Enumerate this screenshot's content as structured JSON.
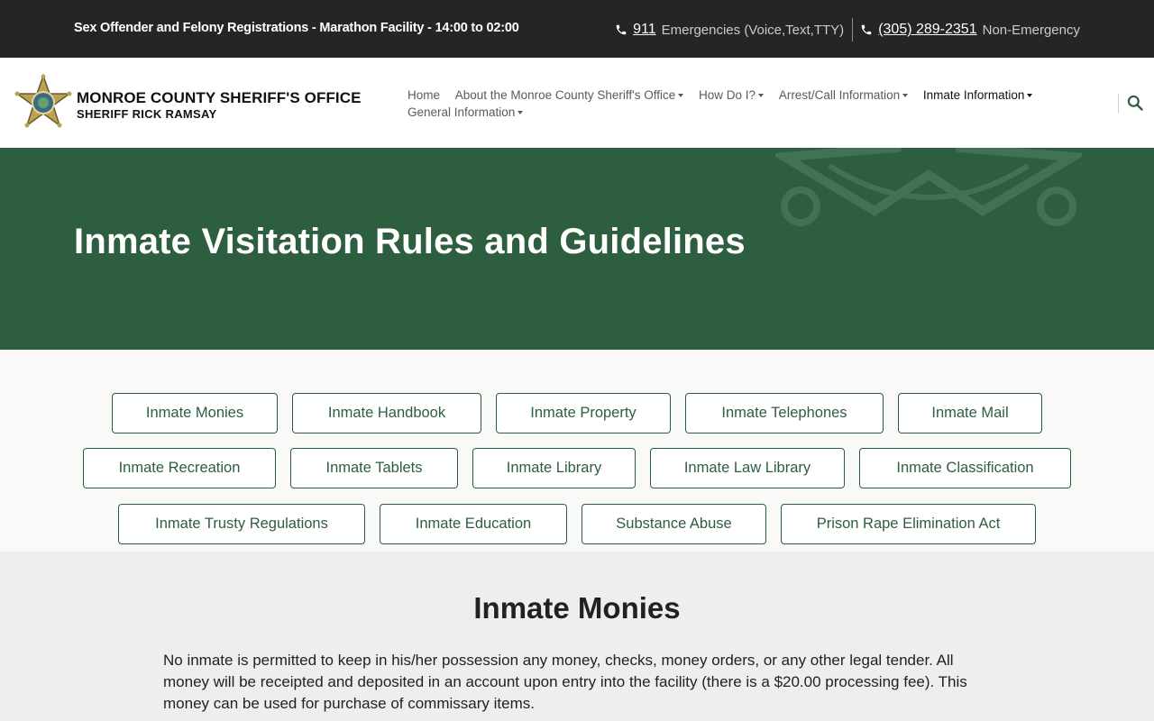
{
  "topbar": {
    "notice": "Sex Offender and Felony Registrations - Marathon Facility - 14:00 to 02:00",
    "emergency_number": "911",
    "emergency_desc": "Emergencies (Voice,Text,TTY)",
    "nonemergency_number": "(305) 289-2351",
    "nonemergency_desc": "Non-Emergency"
  },
  "header": {
    "logo_line1": "MONROE COUNTY SHERIFF'S OFFICE",
    "logo_line2": "SHERIFF RICK RAMSAY",
    "nav": [
      {
        "label": "Home"
      },
      {
        "label": "About the Monroe County Sheriff's Office"
      },
      {
        "label": "How Do I?"
      },
      {
        "label": "Arrest/Call Information"
      },
      {
        "label": "Inmate Information"
      },
      {
        "label": "General Information"
      }
    ]
  },
  "hero": {
    "title": "Inmate Visitation Rules and Guidelines"
  },
  "buttons": [
    "Inmate Monies",
    "Inmate Handbook",
    "Inmate Property",
    "Inmate Telephones",
    "Inmate Mail",
    "Inmate Recreation",
    "Inmate Tablets",
    "Inmate Library",
    "Inmate Law Library",
    "Inmate Classification",
    "Inmate Trusty Regulations",
    "Inmate Education",
    "Substance Abuse",
    "Prison Rape Elimination Act"
  ],
  "section": {
    "heading": "Inmate Monies",
    "body": "No inmate is permitted to keep in his/her possession any money, checks, money orders, or any other legal tender. All money will be receipted and deposited in an account upon entry into the facility (there is a $20.00 processing fee). This money can be used for purchase of commissary items."
  },
  "colors": {
    "brand_green": "#2e5e40",
    "topbar_bg": "#232527"
  }
}
